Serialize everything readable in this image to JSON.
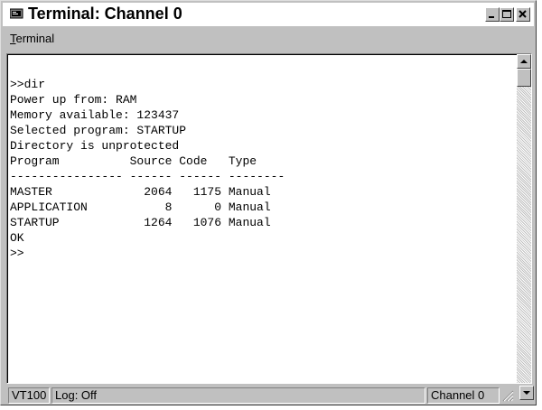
{
  "window": {
    "title": "Terminal: Channel 0"
  },
  "titlebar_buttons": {
    "minimize": "minimize-icon",
    "maximize": "maximize-icon",
    "close": "close-icon"
  },
  "menu": {
    "items": [
      {
        "label": "Terminal",
        "accel": "T",
        "rest": "erminal"
      }
    ]
  },
  "terminal": {
    "lines": [
      ">>dir",
      "Power up from: RAM",
      "Memory available: 123437",
      "Selected program: STARTUP",
      "Directory is unprotected",
      "Program          Source Code   Type",
      "---------------- ------ ------ --------",
      "MASTER             2064   1175 Manual",
      "APPLICATION           8      0 Manual",
      "STARTUP            1264   1076 Manual",
      "OK",
      ">>"
    ]
  },
  "status": {
    "mode": "VT100",
    "log": "Log: Off",
    "channel": "Channel 0"
  }
}
